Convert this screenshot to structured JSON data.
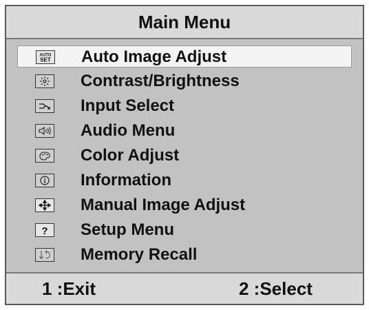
{
  "title": "Main Menu",
  "menu": {
    "items": [
      {
        "label": "Auto Image Adjust",
        "icon": "auto-set-icon",
        "icon_text_top": "AUTO",
        "icon_text_bottom": "SET",
        "selected": true
      },
      {
        "label": "Contrast/Brightness",
        "icon": "contrast-brightness-icon",
        "selected": false
      },
      {
        "label": "Input Select",
        "icon": "input-select-icon",
        "selected": false
      },
      {
        "label": "Audio Menu",
        "icon": "audio-icon",
        "selected": false
      },
      {
        "label": "Color Adjust",
        "icon": "color-adjust-icon",
        "selected": false
      },
      {
        "label": "Information",
        "icon": "info-icon",
        "icon_glyph": "i",
        "selected": false
      },
      {
        "label": "Manual Image Adjust",
        "icon": "manual-adjust-icon",
        "selected": false
      },
      {
        "label": "Setup Menu",
        "icon": "setup-question-icon",
        "icon_glyph": "?",
        "selected": false
      },
      {
        "label": "Memory Recall",
        "icon": "memory-recall-icon",
        "selected": false
      }
    ]
  },
  "footer": {
    "exit_label": "1 :Exit",
    "select_label": "2 :Select"
  },
  "colors": {
    "panel_bg": "#c2c2c2",
    "bar_bg": "#d9d9d9",
    "selected_bg": "#f4f4f4",
    "text": "#111111"
  }
}
